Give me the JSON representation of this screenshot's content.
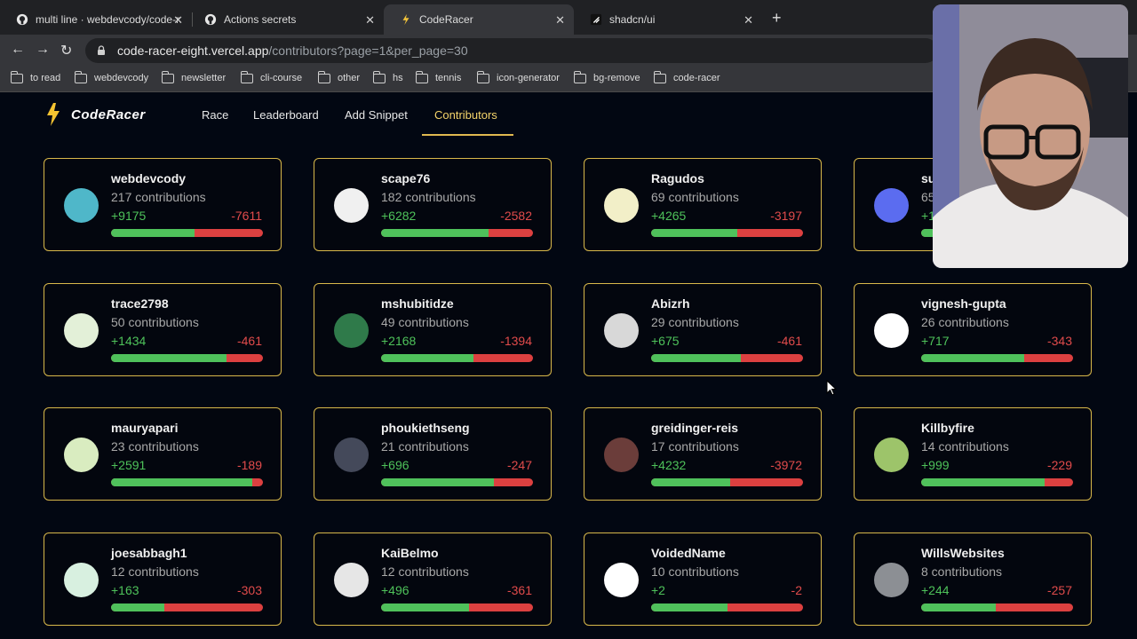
{
  "browser": {
    "tabs": [
      {
        "title": "multi line · webdevcody/code-r",
        "icon": "github-icon",
        "active": false
      },
      {
        "title": "Actions secrets",
        "icon": "github-icon",
        "active": false
      },
      {
        "title": "CodeRacer",
        "icon": "bolt-icon",
        "active": true
      },
      {
        "title": "shadcn/ui",
        "icon": "shadcn-icon",
        "active": false
      }
    ],
    "url_host": "code-racer-eight.vercel.app",
    "url_path": "/contributors?page=1&per_page=30",
    "bookmarks": [
      "to read",
      "webdevcody",
      "newsletter",
      "cli-course",
      "other",
      "hs",
      "tennis",
      "icon-generator",
      "bg-remove",
      "code-racer"
    ]
  },
  "site": {
    "logo": "CodeRacer",
    "nav": [
      "Race",
      "Leaderboard",
      "Add Snippet",
      "Contributors"
    ],
    "active_nav": "Contributors"
  },
  "colors": {
    "accent": "#e0b94f",
    "added": "#4fc15b",
    "removed": "#dc4040"
  },
  "contributors": [
    {
      "name": "webdevcody",
      "contributions": "217 contributions",
      "additions": "+9175",
      "deletions": "-7611",
      "ratio": 0.55
    },
    {
      "name": "scape76",
      "contributions": "182 contributions",
      "additions": "+6282",
      "deletions": "-2582",
      "ratio": 0.71
    },
    {
      "name": "Ragudos",
      "contributions": "69 contributions",
      "additions": "+4265",
      "deletions": "-3197",
      "ratio": 0.57
    },
    {
      "name": "su",
      "contributions": "65",
      "additions": "+1",
      "deletions": "",
      "ratio": 0.6
    },
    {
      "name": "trace2798",
      "contributions": "50 contributions",
      "additions": "+1434",
      "deletions": "-461",
      "ratio": 0.76
    },
    {
      "name": "mshubitidze",
      "contributions": "49 contributions",
      "additions": "+2168",
      "deletions": "-1394",
      "ratio": 0.61
    },
    {
      "name": "Abizrh",
      "contributions": "29 contributions",
      "additions": "+675",
      "deletions": "-461",
      "ratio": 0.59
    },
    {
      "name": "vignesh-gupta",
      "contributions": "26 contributions",
      "additions": "+717",
      "deletions": "-343",
      "ratio": 0.68
    },
    {
      "name": "mauryapari",
      "contributions": "23 contributions",
      "additions": "+2591",
      "deletions": "-189",
      "ratio": 0.93
    },
    {
      "name": "phoukiethseng",
      "contributions": "21 contributions",
      "additions": "+696",
      "deletions": "-247",
      "ratio": 0.74
    },
    {
      "name": "greidinger-reis",
      "contributions": "17 contributions",
      "additions": "+4232",
      "deletions": "-3972",
      "ratio": 0.52
    },
    {
      "name": "Killbyfire",
      "contributions": "14 contributions",
      "additions": "+999",
      "deletions": "-229",
      "ratio": 0.81
    },
    {
      "name": "joesabbagh1",
      "contributions": "12 contributions",
      "additions": "+163",
      "deletions": "-303",
      "ratio": 0.35
    },
    {
      "name": "KaiBelmo",
      "contributions": "12 contributions",
      "additions": "+496",
      "deletions": "-361",
      "ratio": 0.58
    },
    {
      "name": "VoidedName",
      "contributions": "10 contributions",
      "additions": "+2",
      "deletions": "-2",
      "ratio": 0.5
    },
    {
      "name": "WillsWebsites",
      "contributions": "8 contributions",
      "additions": "+244",
      "deletions": "-257",
      "ratio": 0.49
    }
  ]
}
